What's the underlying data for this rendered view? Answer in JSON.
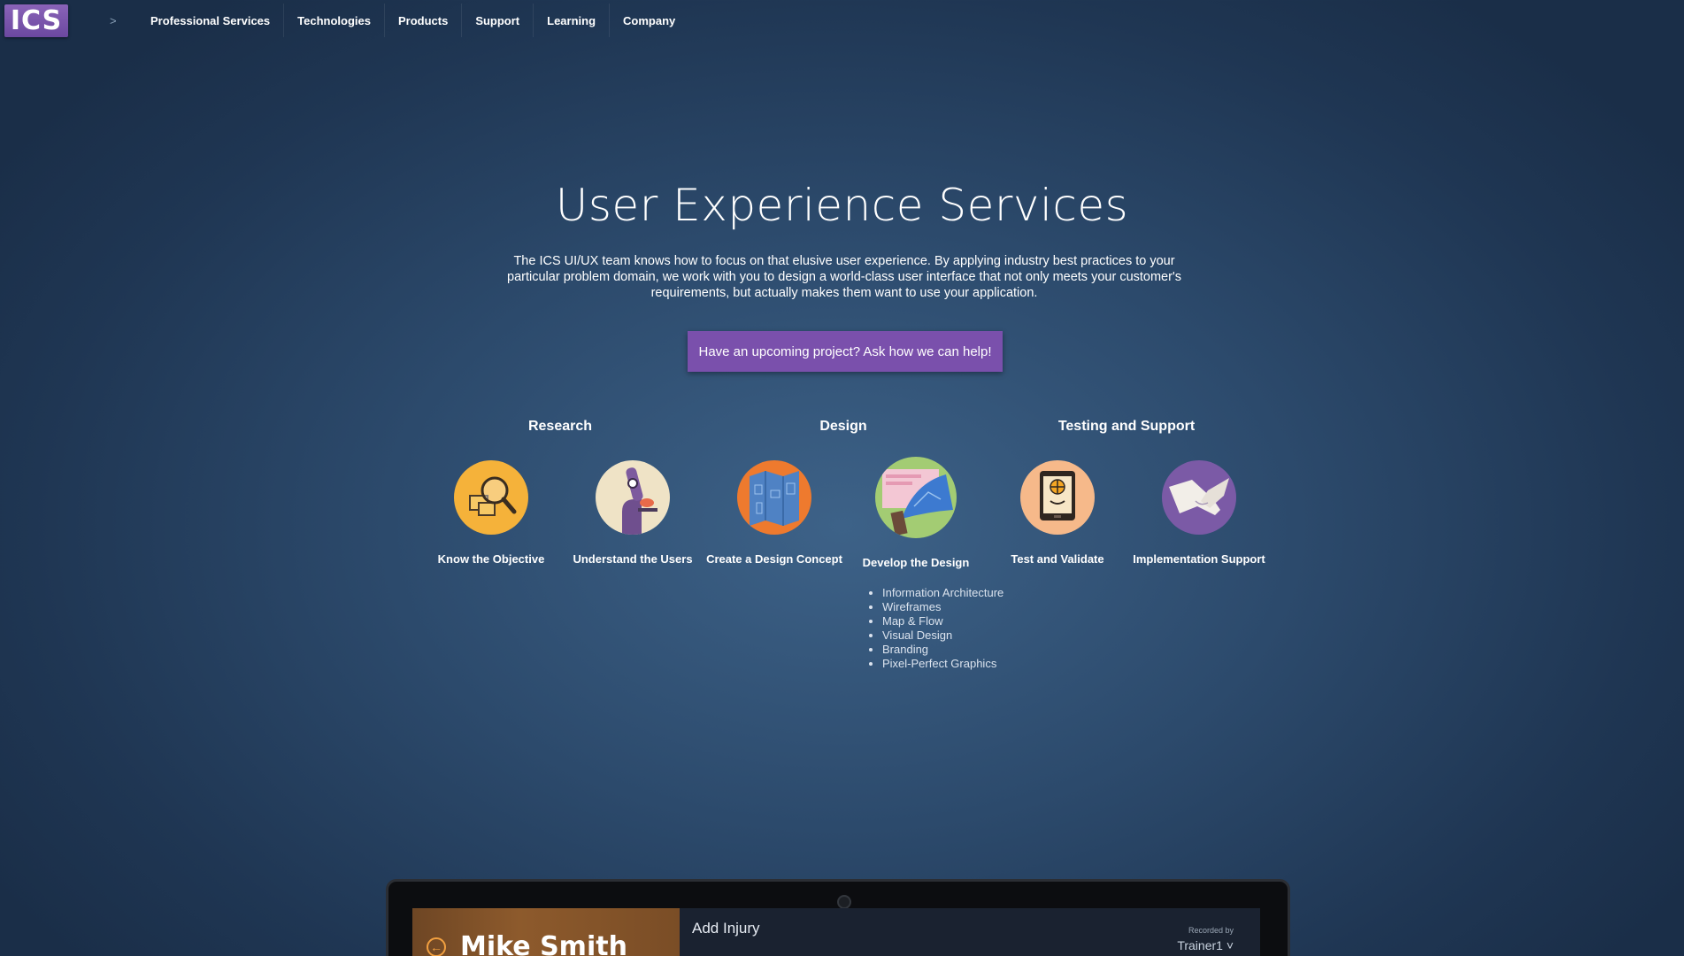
{
  "header": {
    "logo_text": "ICS",
    "breadcrumb_caret": ">",
    "nav": [
      {
        "label": "Professional Services"
      },
      {
        "label": "Technologies"
      },
      {
        "label": "Products"
      },
      {
        "label": "Support"
      },
      {
        "label": "Learning"
      },
      {
        "label": "Company"
      }
    ]
  },
  "hero": {
    "title": "User Experience Services",
    "description": "The ICS UI/UX team knows how to focus on that elusive user experience. By applying industry best practices to your particular problem domain, we work with you to design a world-class user interface that not only meets your customer's requirements, but actually makes them want to use your application.",
    "cta_label": "Have an upcoming project? Ask how we can help!"
  },
  "phases": [
    {
      "label": "Research"
    },
    {
      "label": "Design"
    },
    {
      "label": "Testing and Support"
    }
  ],
  "steps": [
    {
      "label": "Know the Objective",
      "icon": "magnifier-icon",
      "color": "#f5b23a"
    },
    {
      "label": "Understand the Users",
      "icon": "microscope-icon",
      "color": "#efe3c6"
    },
    {
      "label": "Create a Design Concept",
      "icon": "blueprint-map-icon",
      "color": "#ee7a2e"
    },
    {
      "label": "Develop the Design",
      "icon": "wireframe-icon",
      "color": "#a3cc73"
    },
    {
      "label": "Test and Validate",
      "icon": "tablet-test-icon",
      "color": "#f6b98a"
    },
    {
      "label": "Implementation Support",
      "icon": "handshake-icon",
      "color": "#7b5aa6"
    }
  ],
  "develop_bullets": [
    "Information Architecture",
    "Wireframes",
    "Map & Flow",
    "Visual Design",
    "Branding",
    "Pixel-Perfect Graphics"
  ],
  "device": {
    "patient_name": "Mike Smith",
    "screen_title": "Add Injury",
    "recorded_by_label": "Recorded by",
    "recorded_by_value": "Trainer1 ˅",
    "back_glyph": "←"
  },
  "colors": {
    "accent": "#7a50ac",
    "background": "#2c4a6c"
  }
}
